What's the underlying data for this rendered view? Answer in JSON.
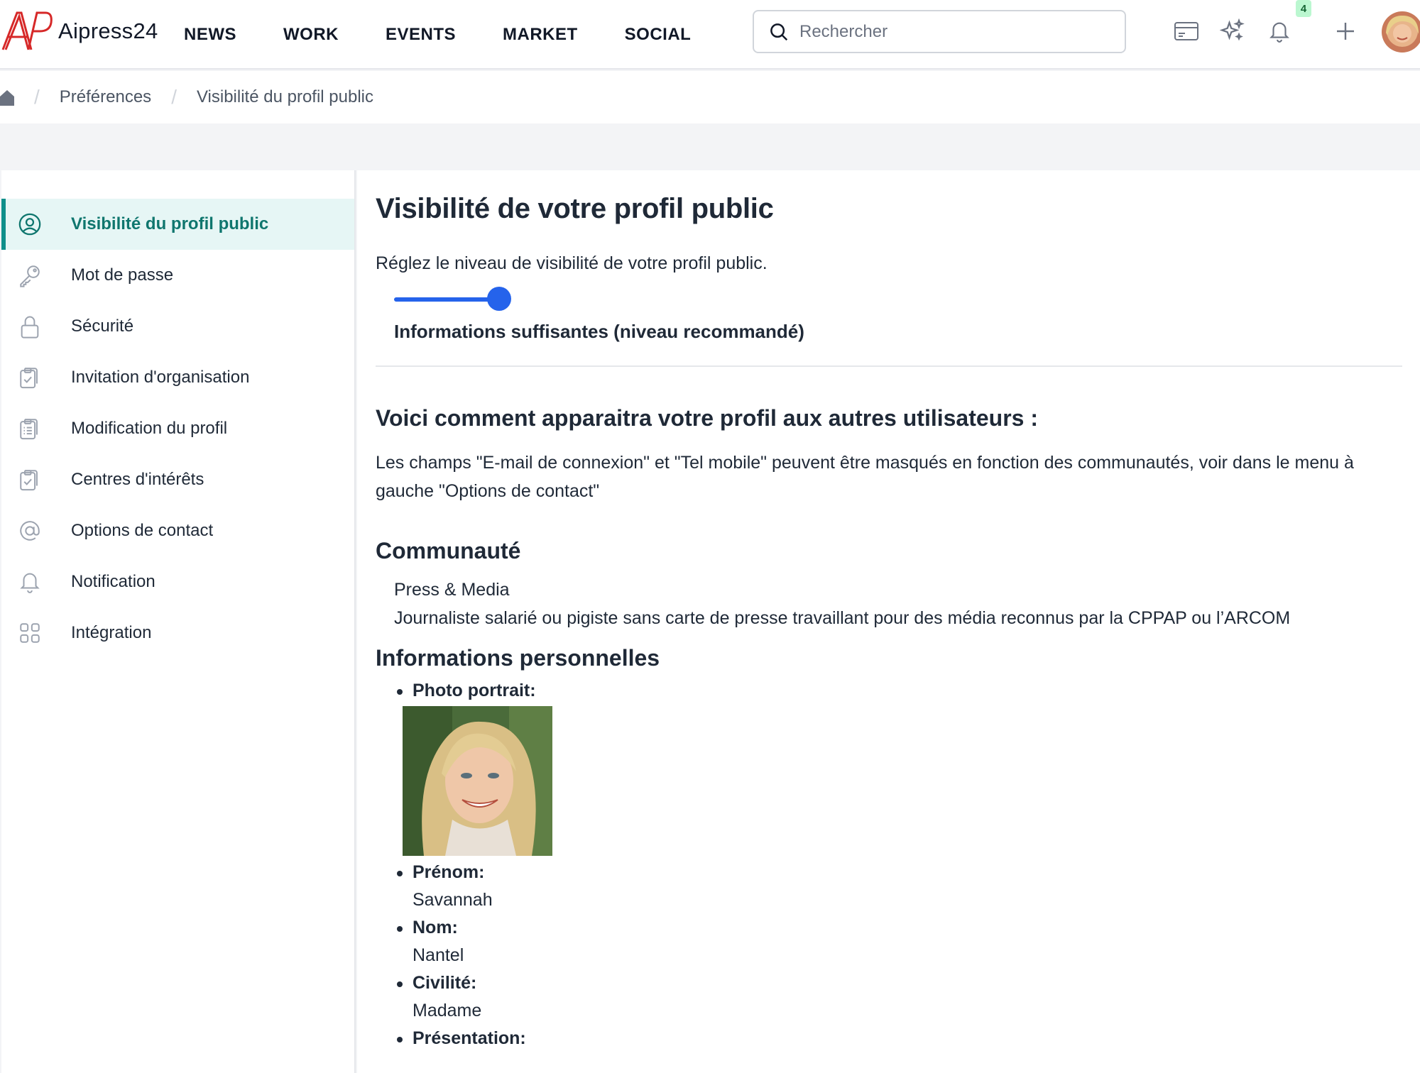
{
  "header": {
    "logo_text": "Aipress24",
    "nav": [
      "NEWS",
      "WORK",
      "EVENTS",
      "MARKET",
      "SOCIAL"
    ],
    "search_placeholder": "Rechercher",
    "notification_count": "4",
    "brand_color": "#d62828"
  },
  "breadcrumb": [
    "Préférences",
    "Visibilité du profil public"
  ],
  "sidebar": {
    "active_color": "#0f766e",
    "items": [
      {
        "label": "Visibilité du profil public",
        "icon": "user-circle-icon",
        "active": true
      },
      {
        "label": "Mot de passe",
        "icon": "key-icon"
      },
      {
        "label": "Sécurité",
        "icon": "lock-icon"
      },
      {
        "label": "Invitation d'organisation",
        "icon": "clipboard-check-icon"
      },
      {
        "label": "Modification du profil",
        "icon": "clipboard-list-icon"
      },
      {
        "label": "Centres d'intérêts",
        "icon": "clipboard-check-icon"
      },
      {
        "label": "Options de contact",
        "icon": "at-sign-icon"
      },
      {
        "label": "Notification",
        "icon": "bell-icon"
      },
      {
        "label": "Intégration",
        "icon": "grid-icon"
      }
    ]
  },
  "main": {
    "title": "Visibilité de votre profil public",
    "subtitle": "Réglez le niveau de visibilité de votre profil public.",
    "slider": {
      "value": 0.7,
      "color": "#2563eb"
    },
    "level_label": "Informations suffisantes (niveau recommandé)",
    "preview_title": "Voici comment apparaitra votre profil aux autres utilisateurs :",
    "preview_text": "Les champs \"E-mail de connexion\" et \"Tel mobile\" peuvent être masqués en fonction des communautés, voir dans le menu à gauche \"Options de contact\"",
    "community": {
      "title": "Communauté",
      "name": "Press & Media",
      "description": "Journaliste salarié ou pigiste sans carte de presse travaillant pour des média reconnus par la CPPAP ou l’ARCOM"
    },
    "personal": {
      "title": "Informations personnelles",
      "photo_label": "Photo portrait:",
      "fields": [
        {
          "label": "Prénom:",
          "value": "Savannah"
        },
        {
          "label": "Nom:",
          "value": "Nantel"
        },
        {
          "label": "Civilité:",
          "value": "Madame"
        },
        {
          "label": "Présentation:",
          "value": ""
        }
      ]
    }
  }
}
